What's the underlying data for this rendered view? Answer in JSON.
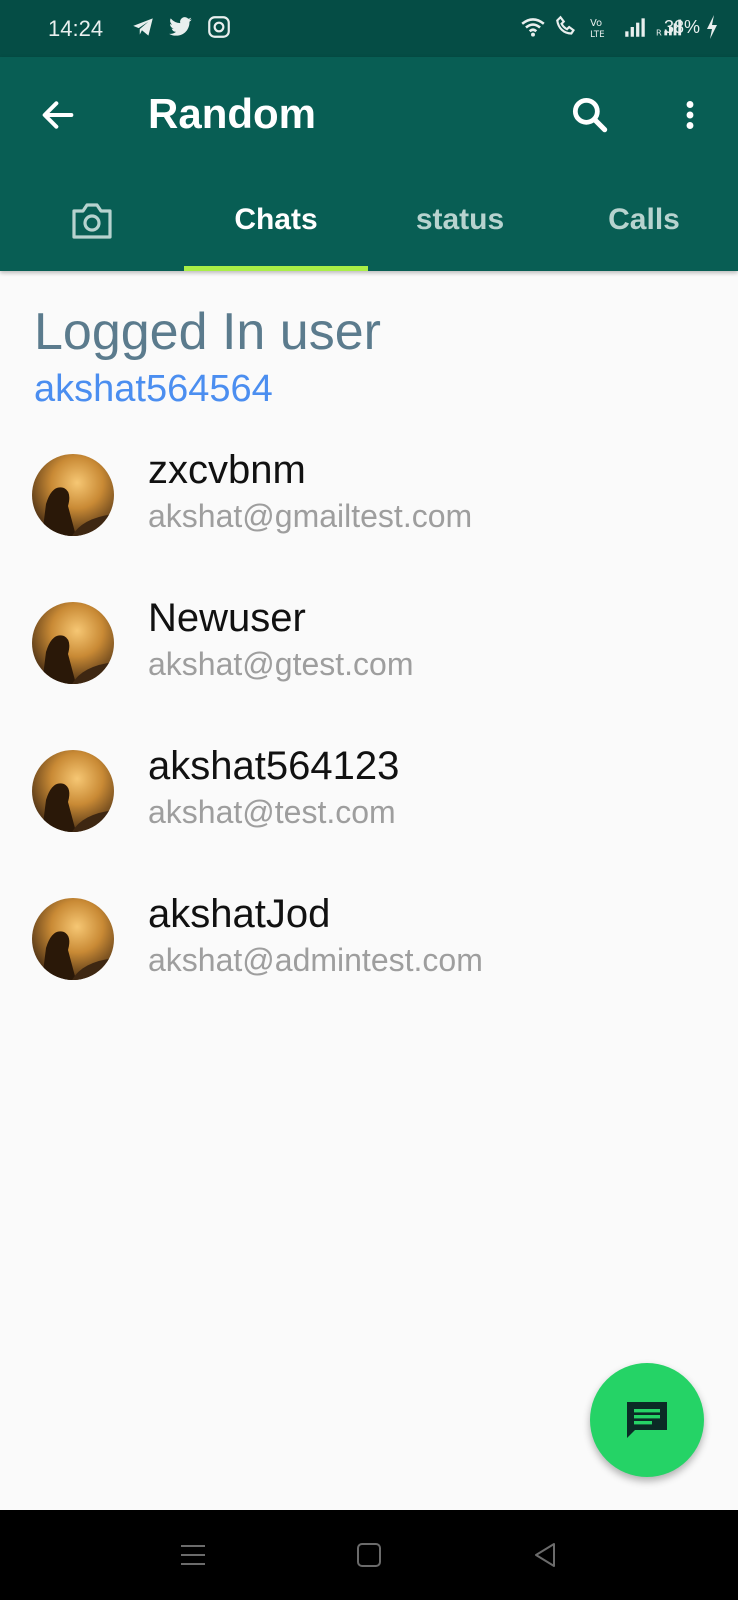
{
  "status_bar": {
    "time": "14:24",
    "battery": "38%"
  },
  "app_bar": {
    "title": "Random"
  },
  "tabs": [
    {
      "label": "Chats",
      "active": true
    },
    {
      "label": "status",
      "active": false
    },
    {
      "label": "Calls",
      "active": false
    }
  ],
  "header": {
    "label": "Logged In user",
    "username": "akshat564564"
  },
  "chats": [
    {
      "name": "zxcvbnm",
      "email": "akshat@gmailtest.com"
    },
    {
      "name": "Newuser",
      "email": "akshat@gtest.com"
    },
    {
      "name": "akshat564123",
      "email": "akshat@test.com"
    },
    {
      "name": "akshatJod",
      "email": "akshat@admintest.com"
    }
  ],
  "colors": {
    "status_bar": "#054d45",
    "app_bar": "#085e54",
    "tab_indicator": "#a9ef46",
    "fab": "#25d366",
    "username": "#4b8ef0",
    "header_label": "#5b7b8d"
  }
}
